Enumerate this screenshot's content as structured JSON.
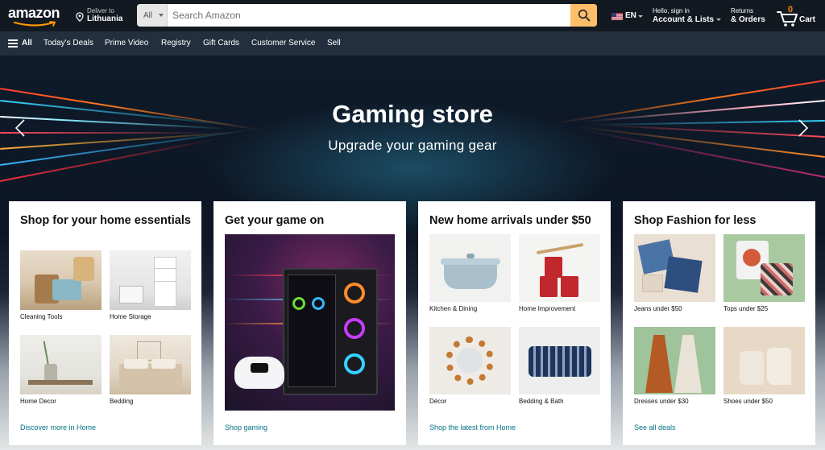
{
  "nav": {
    "logo": "amazon",
    "deliver_line1": "Deliver to",
    "deliver_line2": "Lithuania",
    "search_category": "All",
    "search_placeholder": "Search Amazon",
    "language": "EN",
    "account_line1": "Hello, sign in",
    "account_line2": "Account & Lists",
    "returns_line1": "Returns",
    "returns_line2": "& Orders",
    "cart_count": "0",
    "cart_label": "Cart"
  },
  "subnav": {
    "all": "All",
    "items": [
      "Today's Deals",
      "Prime Video",
      "Registry",
      "Gift Cards",
      "Customer Service",
      "Sell"
    ]
  },
  "hero": {
    "title": "Gaming store",
    "subtitle": "Upgrade your gaming gear"
  },
  "cards": [
    {
      "title": "Shop for your home essentials",
      "tiles": [
        "Cleaning Tools",
        "Home Storage",
        "Home Decor",
        "Bedding"
      ],
      "link": "Discover more in Home"
    },
    {
      "title": "Get your game on",
      "link": "Shop gaming"
    },
    {
      "title": "New home arrivals under $50",
      "tiles": [
        "Kitchen & Dining",
        "Home Improvement",
        "Décor",
        "Bedding & Bath"
      ],
      "link": "Shop the latest from Home"
    },
    {
      "title": "Shop Fashion for less",
      "tiles": [
        "Jeans under $50",
        "Tops under $25",
        "Dresses under $30",
        "Shoes under $50"
      ],
      "link": "See all deals"
    }
  ],
  "colors": {
    "nav_bg": "#131921",
    "subnav_bg": "#232f3e",
    "search_button": "#febd69",
    "cart_count": "#f08804",
    "link": "#007185"
  }
}
